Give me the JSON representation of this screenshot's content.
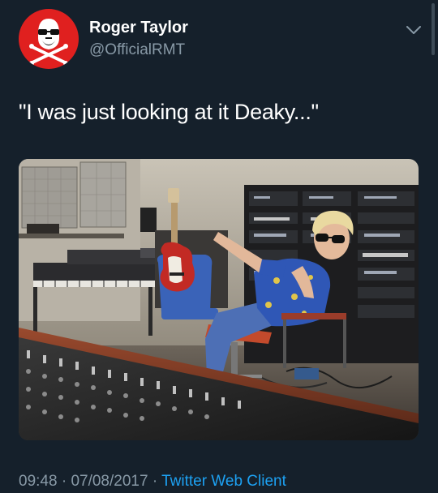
{
  "tweet": {
    "display_name": "Roger Taylor",
    "handle": "@OfficialRMT",
    "text": "\"I was just looking at it Deaky...\"",
    "time": "09:48",
    "date": "07/08/2017",
    "separator": "·",
    "source": "Twitter Web Client"
  },
  "icons": {
    "avatar": "skull-crossbones-sunglasses-logo",
    "menu": "chevron-down-icon"
  },
  "colors": {
    "background": "#15202b",
    "avatar_bg": "#e0201f",
    "secondary_text": "#8899a6",
    "link": "#1da1f2"
  }
}
